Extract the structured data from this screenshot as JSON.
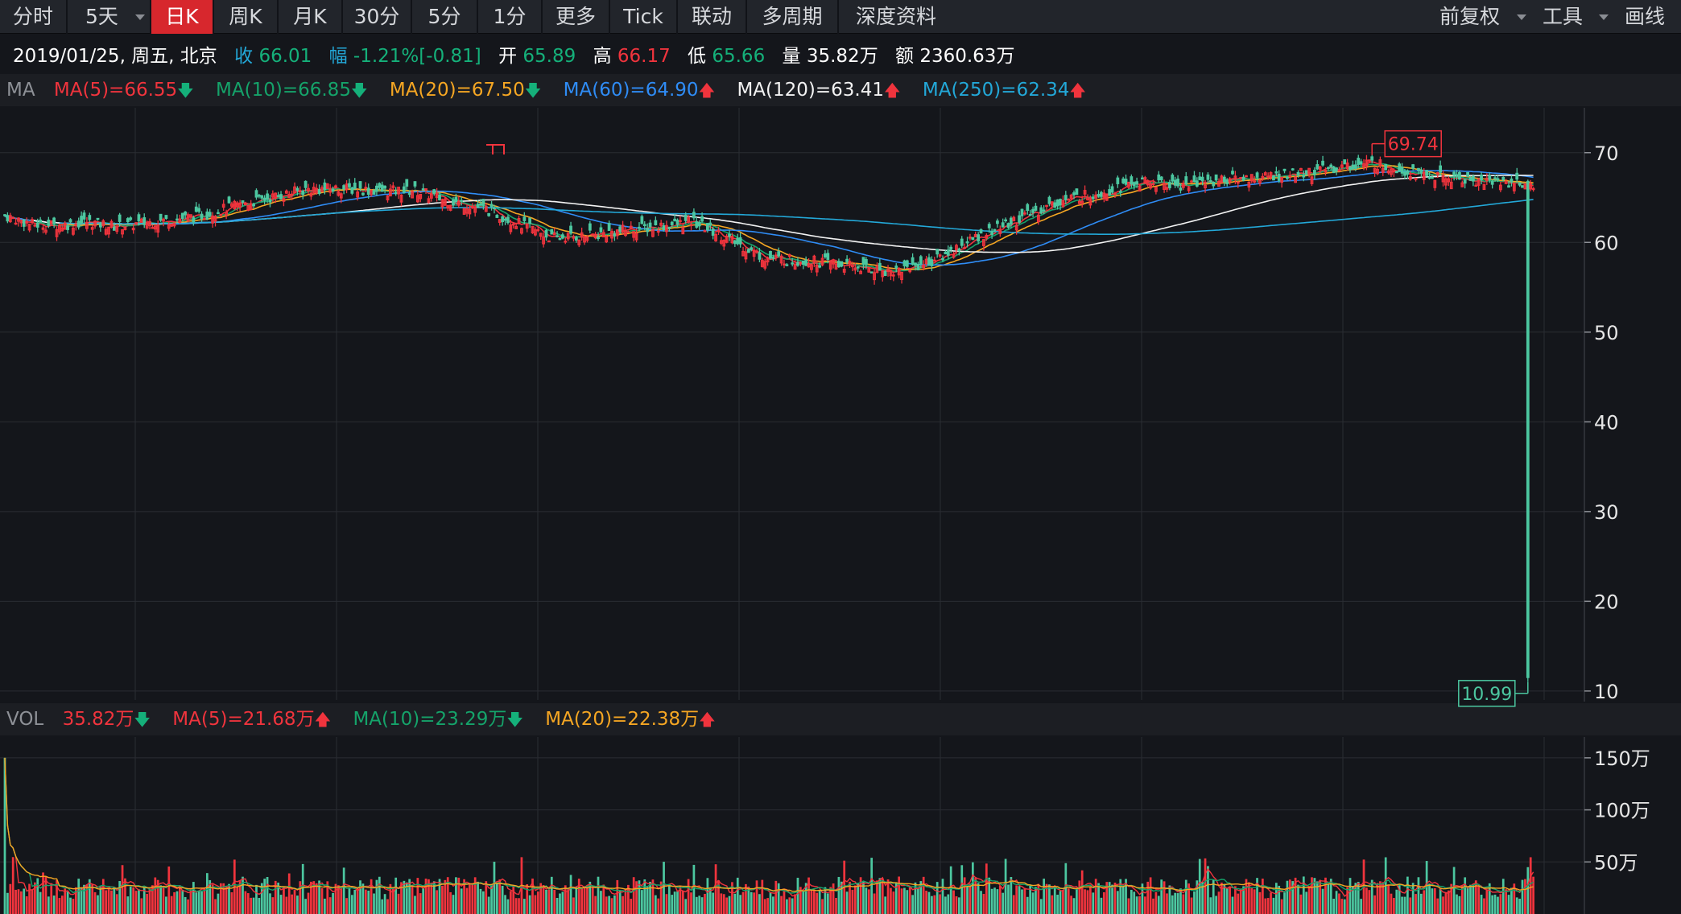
{
  "toolbar": {
    "tabs": [
      {
        "label": "分时"
      },
      {
        "label": "5天"
      },
      {
        "label": "日K"
      },
      {
        "label": "周K"
      },
      {
        "label": "月K"
      },
      {
        "label": "30分"
      },
      {
        "label": "5分"
      },
      {
        "label": "1分"
      },
      {
        "label": "更多"
      },
      {
        "label": "Tick"
      },
      {
        "label": "联动"
      },
      {
        "label": "多周期"
      },
      {
        "label": "深度资料"
      }
    ],
    "active_tab": "日K",
    "right": {
      "adjust": "前复权",
      "tools": "工具",
      "draw": "画线"
    }
  },
  "info": {
    "date": "2019/01/25, 周五, 北京",
    "close_label": "收",
    "close": "66.01",
    "change_label": "幅",
    "change_pct": "-1.21%",
    "change_abs": "[-0.81]",
    "open_label": "开",
    "open": "65.89",
    "high_label": "高",
    "high": "66.17",
    "low_label": "低",
    "low": "65.66",
    "volume_label": "量",
    "volume": "35.82万",
    "amount_label": "额",
    "amount": "2360.63万"
  },
  "ma_legend": {
    "label": "MA",
    "items": [
      {
        "text": "MA(5)=66.55",
        "dir": "down",
        "color": "#f0343d"
      },
      {
        "text": "MA(10)=66.85",
        "dir": "down",
        "color": "#15a36a"
      },
      {
        "text": "MA(20)=67.50",
        "dir": "down",
        "color": "#f5a623"
      },
      {
        "text": "MA(60)=64.90",
        "dir": "up",
        "color": "#2f8cf5"
      },
      {
        "text": "MA(120)=63.41",
        "dir": "up",
        "color": "#f2f2f2"
      },
      {
        "text": "MA(250)=62.34",
        "dir": "up",
        "color": "#23a8d8"
      }
    ]
  },
  "vol_legend": {
    "label": "VOL",
    "items": [
      {
        "text": "35.82万",
        "dir": "down",
        "color": "#f0343d"
      },
      {
        "text": "MA(5)=21.68万",
        "dir": "up",
        "color": "#f0343d"
      },
      {
        "text": "MA(10)=23.29万",
        "dir": "down",
        "color": "#15a36a"
      },
      {
        "text": "MA(20)=22.38万",
        "dir": "up",
        "color": "#f5a623"
      }
    ]
  },
  "colors": {
    "up": "#f0343d",
    "down": "#4cc7a0",
    "background": "#14161b",
    "grid": "#2a2d33",
    "axis_text": "#e6e6e6"
  },
  "chart_data": {
    "type": "candlestick",
    "title": "",
    "price_axis": {
      "ticks": [
        "70",
        "60",
        "50",
        "40",
        "30",
        "20",
        "10"
      ],
      "ylim": [
        9,
        75
      ]
    },
    "volume_axis": {
      "ticks": [
        "150万",
        "100万",
        "50万"
      ],
      "ylim": [
        0,
        170
      ]
    },
    "annotations": {
      "high": "69.74",
      "low": "10.99"
    },
    "grid": true,
    "ma_series": [
      {
        "name": "MA(5)",
        "last": 66.55
      },
      {
        "name": "MA(10)",
        "last": 66.85
      },
      {
        "name": "MA(20)",
        "last": 67.5
      },
      {
        "name": "MA(60)",
        "last": 64.9
      },
      {
        "name": "MA(120)",
        "last": 63.41
      },
      {
        "name": "MA(250)",
        "last": 62.34
      }
    ],
    "close_path": [
      [
        0,
        63.0
      ],
      [
        10,
        62.0
      ],
      [
        20,
        61.9
      ],
      [
        30,
        62.3
      ],
      [
        40,
        61.8
      ],
      [
        55,
        62.3
      ],
      [
        70,
        62.9
      ],
      [
        90,
        64.5
      ],
      [
        110,
        65.9
      ],
      [
        125,
        66.0
      ],
      [
        140,
        65.7
      ],
      [
        150,
        65.8
      ],
      [
        160,
        64.8
      ],
      [
        175,
        63.8
      ],
      [
        185,
        62.5
      ],
      [
        200,
        60.5
      ],
      [
        215,
        60.8
      ],
      [
        230,
        61.5
      ],
      [
        245,
        62.0
      ],
      [
        252,
        62.3
      ],
      [
        262,
        60.8
      ],
      [
        278,
        58.3
      ],
      [
        290,
        58.0
      ],
      [
        300,
        57.8
      ],
      [
        310,
        57.3
      ],
      [
        325,
        56.8
      ],
      [
        340,
        58.0
      ],
      [
        355,
        60.5
      ],
      [
        370,
        62.5
      ],
      [
        385,
        64.5
      ],
      [
        400,
        65.6
      ],
      [
        415,
        66.7
      ],
      [
        430,
        66.4
      ],
      [
        445,
        67.0
      ],
      [
        460,
        67.3
      ],
      [
        475,
        67.7
      ],
      [
        490,
        68.5
      ],
      [
        500,
        68.8
      ],
      [
        510,
        68.2
      ],
      [
        520,
        67.4
      ],
      [
        532,
        67.0
      ],
      [
        545,
        66.8
      ],
      [
        555,
        66.6
      ],
      [
        560,
        66.0
      ]
    ],
    "bars": 560,
    "last_bar": {
      "open": 65.89,
      "high": 66.17,
      "low": 65.66,
      "close": 66.01,
      "volume": 35.82
    },
    "spike_bar": {
      "index": 557,
      "open": 66.8,
      "high": 67.0,
      "low": 10.99,
      "close": 11.5,
      "volume": 45
    }
  }
}
